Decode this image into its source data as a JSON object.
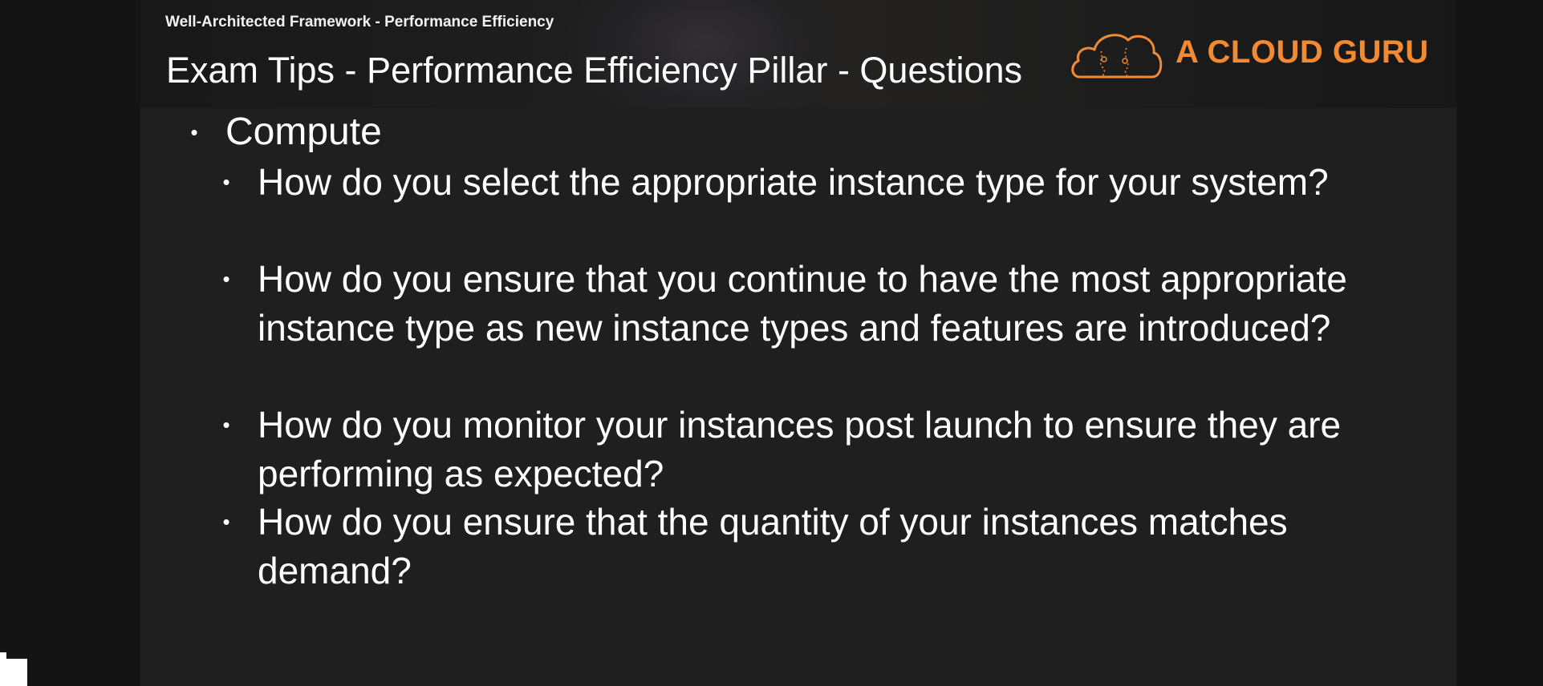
{
  "header": {
    "course_title": "Well-Architected Framework - Performance Efficiency",
    "slide_title": "Exam Tips - Performance Efficiency Pillar - Questions",
    "logo_text": "A CLOUD GURU",
    "logo_icon": "cloud-icon"
  },
  "colors": {
    "brand_orange": "#f28a32",
    "slide_background": "#1f1f1f",
    "text": "#ffffff"
  },
  "content": {
    "section": "Compute",
    "questions": [
      "How do you select the appropriate instance type for your system?",
      "How do you ensure that you continue to have the most appropriate instance type as new instance types and features are introduced?",
      "How do you monitor your instances post launch to ensure they are performing as expected?",
      "How do you ensure that the quantity of your instances matches demand?"
    ]
  }
}
